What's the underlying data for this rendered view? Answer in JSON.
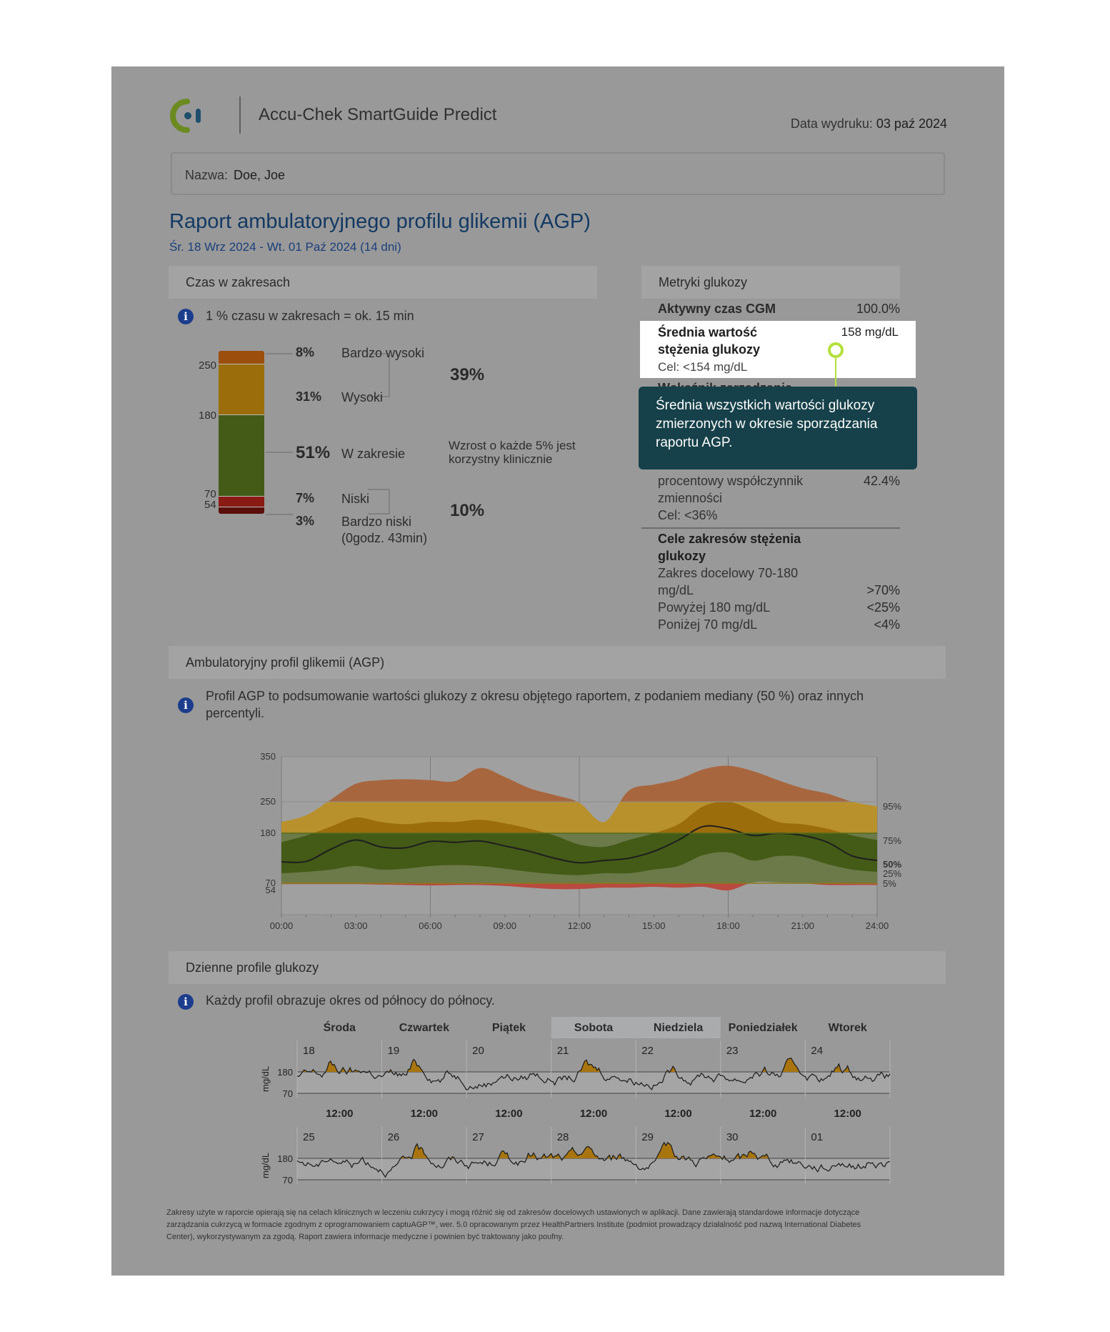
{
  "header": {
    "app_title": "Accu-Chek SmartGuide Predict",
    "print_date_label": "Data wydruku:",
    "print_date_value": "03 paź 2024",
    "name_label": "Nazwa:",
    "name_value": "Doe, Joe"
  },
  "report": {
    "title": "Raport ambulatoryjnego profilu glikemii (AGP)",
    "date_range": "Śr. 18 Wrz 2024 - Wt. 01 Paź 2024 (14 dni)"
  },
  "time_in_ranges": {
    "section_title": "Czas w zakresach",
    "info_text": "1 % czasu w zakresach = ok. 15 min",
    "axis_labels": [
      "250",
      "180",
      "70",
      "54"
    ],
    "rows": [
      {
        "pct": "8%",
        "label": "Bardzo wysoki",
        "value": 8
      },
      {
        "pct": "31%",
        "label": "Wysoki",
        "value": 31
      },
      {
        "pct": "51%",
        "label": "W zakresie",
        "value": 51
      },
      {
        "pct": "7%",
        "label": "Niski",
        "value": 7
      },
      {
        "pct": "3%",
        "label": "Bardzo niski",
        "value": 3
      }
    ],
    "very_low_duration": "(0godz. 43min)",
    "high_total": "39%",
    "low_total": "10%",
    "in_range_note_1": "Wzrost o każde 5% jest",
    "in_range_note_2": "korzystny klinicznie",
    "colors": {
      "very_high": "#9c4f0c",
      "high": "#9c6e0b",
      "in_range": "#445a17",
      "low": "#8a1a14",
      "very_low": "#5a0f0b"
    }
  },
  "glucose_metrics": {
    "section_title": "Metryki glukozy",
    "active_cgm_label": "Aktywny czas CGM",
    "active_cgm_value": "100.0%",
    "mean_label_1": "Średnia wartość",
    "mean_label_2": "stężenia glukozy",
    "mean_value": "158 mg/dL",
    "mean_target": "Cel: <154 mg/dL",
    "gmi_partial": "Wskaźnik zarządzania",
    "cv_label_1": "procentowy współczynnik",
    "cv_label_2": "zmienności",
    "cv_value": "42.4%",
    "cv_target": "Cel: <36%",
    "goals_title_1": "Cele zakresów stężenia",
    "goals_title_2": "glukozy",
    "goal_1a": "Zakres docelowy 70-180",
    "goal_1b": "mg/dL",
    "goal_1_value": ">70%",
    "goal_2": "Powyżej 180 mg/dL",
    "goal_2_value": "<25%",
    "goal_3": "Poniżej 70 mg/dL",
    "goal_3_value": "<4%"
  },
  "tooltip": {
    "line_1": "Średnia wszystkich wartości glukozy",
    "line_2": "zmierzonych w okresie sporządzania",
    "line_3": "raportu AGP."
  },
  "agp": {
    "section_title": "Ambulatoryjny profil glikemii (AGP)",
    "info_text_1": "Profil AGP to podsumowanie wartości glukozy z okresu objętego raportem, z podaniem mediany (50 %) oraz innych",
    "info_text_2": "percentyli."
  },
  "chart_data": {
    "type": "area",
    "x_ticks": [
      "00:00",
      "03:00",
      "06:00",
      "09:00",
      "12:00",
      "15:00",
      "18:00",
      "21:00",
      "24:00"
    ],
    "y_ticks": [
      "350",
      "250",
      "180",
      "70",
      "54"
    ],
    "ylim": [
      40,
      350
    ],
    "target_range": [
      70,
      180
    ],
    "percentile_labels": [
      "95%",
      "75%",
      "50%",
      "25%",
      "5%"
    ],
    "x_hours": [
      0,
      1,
      2,
      3,
      4,
      5,
      6,
      7,
      8,
      9,
      10,
      11,
      12,
      13,
      14,
      15,
      16,
      17,
      18,
      19,
      20,
      21,
      22,
      23,
      24
    ],
    "series": [
      {
        "name": "95%",
        "values": [
          205,
          220,
          255,
          290,
          298,
          300,
          298,
          296,
          325,
          305,
          280,
          265,
          248,
          205,
          275,
          288,
          300,
          322,
          330,
          318,
          298,
          280,
          268,
          250,
          240
        ]
      },
      {
        "name": "75%",
        "values": [
          160,
          175,
          195,
          215,
          205,
          200,
          205,
          205,
          210,
          202,
          190,
          175,
          155,
          150,
          165,
          180,
          200,
          240,
          250,
          230,
          205,
          200,
          190,
          175,
          165
        ]
      },
      {
        "name": "50%",
        "values": [
          117,
          118,
          145,
          165,
          150,
          148,
          162,
          160,
          163,
          152,
          140,
          125,
          115,
          120,
          125,
          140,
          165,
          195,
          190,
          175,
          180,
          175,
          160,
          130,
          120
        ]
      },
      {
        "name": "25%",
        "values": [
          92,
          95,
          100,
          108,
          100,
          102,
          108,
          110,
          108,
          102,
          95,
          90,
          88,
          92,
          92,
          100,
          108,
          132,
          138,
          120,
          130,
          128,
          112,
          100,
          95
        ]
      },
      {
        "name": "5%",
        "values": [
          68,
          68,
          68,
          68,
          67,
          66,
          65,
          66,
          66,
          64,
          60,
          57,
          57,
          60,
          60,
          62,
          60,
          62,
          54,
          72,
          72,
          70,
          66,
          66,
          66
        ]
      }
    ]
  },
  "daily": {
    "section_title": "Dzienne profile glukozy",
    "info_text": "Każdy profil obrazuje okres od północy do północy.",
    "weekdays": [
      "Środa",
      "Czwartek",
      "Piątek",
      "Sobota",
      "Niedziela",
      "Poniedziałek",
      "Wtorek"
    ],
    "week1_days": [
      "18",
      "19",
      "20",
      "21",
      "22",
      "23",
      "24"
    ],
    "week2_days": [
      "25",
      "26",
      "27",
      "28",
      "29",
      "30",
      "01"
    ],
    "noon_label": "12:00",
    "y_unit": "mg/dL",
    "y_ticks": [
      "180",
      "70"
    ]
  },
  "footer": {
    "line_1": "Zakresy użyte w raporcie opierają się na celach klinicznych w leczeniu cukrzycy i mogą różnić się od zakresów docelowych ustawionych w aplikacji. Dane zawierają standardowe informacje dotyczące",
    "line_2": "zarządzania cukrzycą w formacie zgodnym z oprogramowaniem captuAGP™, wer. 5.0 opracowanym przez HealthPartners Institute (podmiot prowadzący działalność pod nazwą International Diabetes",
    "line_3": "Center), wykorzystywanym za zgodą. Raport zawiera informacje medyczne i powinien być traktowany jako poufny."
  }
}
